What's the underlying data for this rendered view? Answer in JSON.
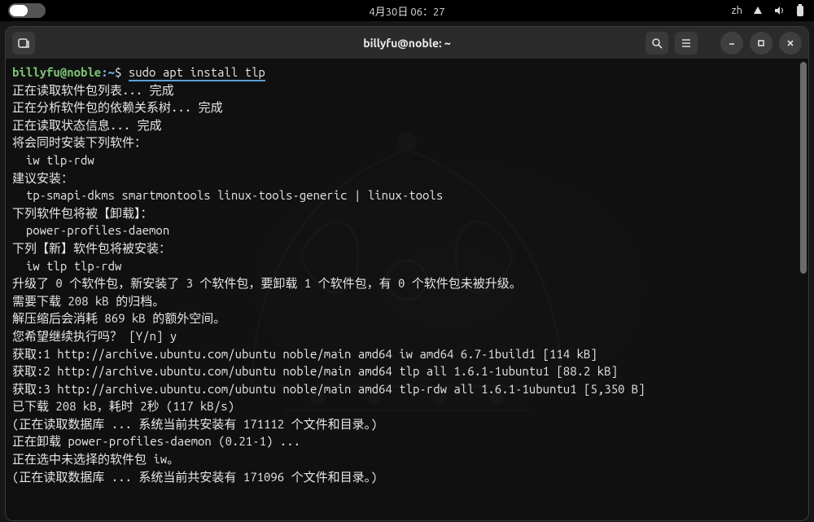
{
  "topbar": {
    "datetime": "4月30日 06：27",
    "input_method": "zh"
  },
  "titlebar": {
    "title": "billyfu@noble: ~"
  },
  "prompt": {
    "user": "billyfu@noble",
    "colon": ":",
    "path": "~",
    "dollar": "$",
    "command": "sudo apt install tlp"
  },
  "output": [
    "正在读取软件包列表... 完成",
    "正在分析软件包的依赖关系树... 完成",
    "正在读取状态信息... 完成",
    "将会同时安装下列软件：",
    "  iw tlp-rdw",
    "建议安装：",
    "  tp-smapi-dkms smartmontools linux-tools-generic | linux-tools",
    "下列软件包将被【卸载】：",
    "  power-profiles-daemon",
    "下列【新】软件包将被安装：",
    "  iw tlp tlp-rdw",
    "升级了 0 个软件包，新安装了 3 个软件包，要卸载 1 个软件包，有 0 个软件包未被升级。",
    "需要下载 208 kB 的归档。",
    "解压缩后会消耗 869 kB 的额外空间。",
    "您希望继续执行吗？ [Y/n] y",
    "获取:1 http://archive.ubuntu.com/ubuntu noble/main amd64 iw amd64 6.7-1build1 [114 kB]",
    "获取:2 http://archive.ubuntu.com/ubuntu noble/main amd64 tlp all 1.6.1-1ubuntu1 [88.2 kB]",
    "获取:3 http://archive.ubuntu.com/ubuntu noble/main amd64 tlp-rdw all 1.6.1-1ubuntu1 [5,350 B]",
    "已下载 208 kB，耗时 2秒 (117 kB/s)",
    "(正在读取数据库 ... 系统当前共安装有 171112 个文件和目录。)",
    "正在卸载 power-profiles-daemon (0.21-1) ...",
    "正在选中未选择的软件包 iw。",
    "(正在读取数据库 ... 系统当前共安装有 171096 个文件和目录。)"
  ]
}
